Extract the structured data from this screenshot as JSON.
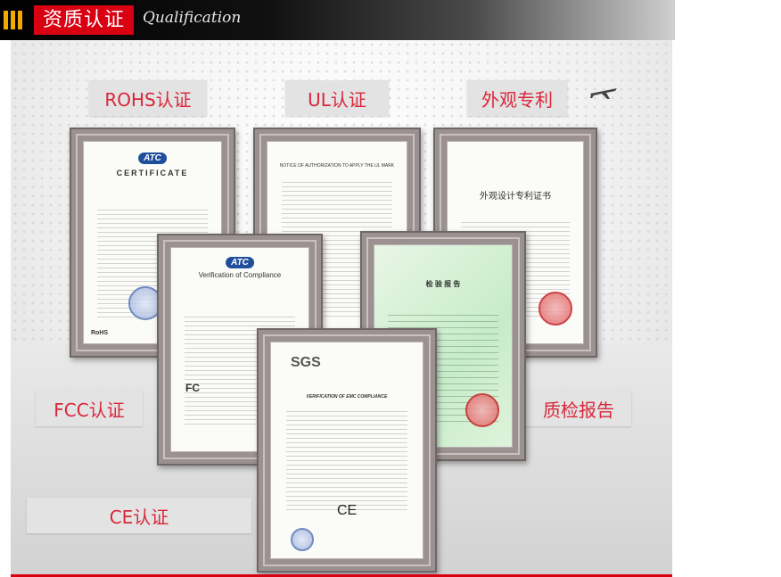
{
  "header": {
    "title": "资质认证",
    "subtitle": "Qualification"
  },
  "tags": {
    "rohs": "ROHS认证",
    "ul": "UL认证",
    "patent": "外观专利",
    "fcc": "FCC认证",
    "report": "质检报告",
    "ce": "CE认证"
  },
  "certificates": {
    "rohs": {
      "logo": "ATC",
      "title": "CERTIFICATE",
      "footer": "RoHS"
    },
    "ul": {
      "title": "NOTICE OF AUTHORIZATION TO APPLY THE UL MARK"
    },
    "patent": {
      "title": "外观设计专利证书"
    },
    "fcc": {
      "logo": "ATC",
      "title": "Verification of Compliance",
      "mark": "FC"
    },
    "report": {
      "title": "检 验 报 告"
    },
    "ce": {
      "logo": "SGS",
      "title": "VERIFICATION OF EMC COMPLIANCE",
      "mark": "CE"
    }
  },
  "colors": {
    "accent_red": "#d90012",
    "header_bar_orange": "#f2a900",
    "tag_text": "#d9263a"
  },
  "icons": [
    "airplane-icon",
    "header-bars-icon"
  ]
}
